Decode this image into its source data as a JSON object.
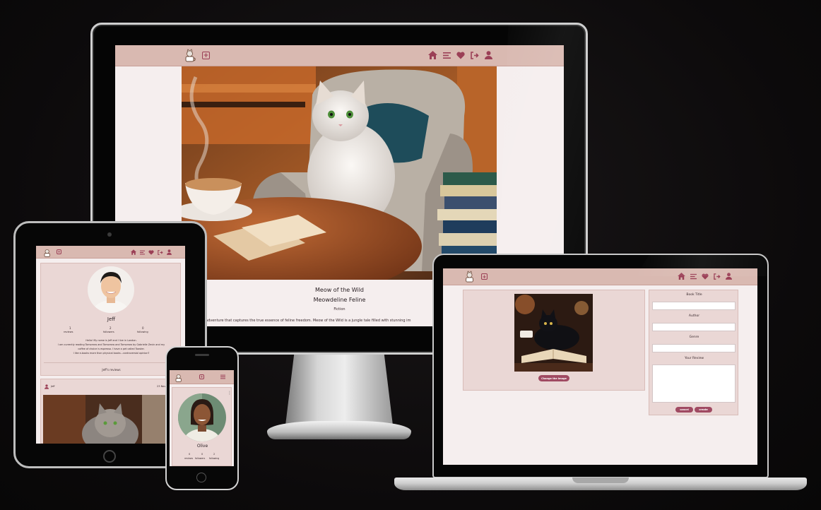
{
  "nav": {
    "icons": [
      "home-icon",
      "menu-icon",
      "heart-icon",
      "sign-out-icon",
      "user-icon"
    ],
    "add_icon": "plus-square-icon",
    "logo": "cat-coffee-logo"
  },
  "desktop": {
    "book_title": "Meow of the Wild",
    "book_author": "Meowdeline Feline",
    "book_genre": "Fiction",
    "book_blurb": "adventure that captures the true essence of feline freedom. Meow of the Wild is a jungle tale filled with stunning im"
  },
  "tablet": {
    "profile_name": "Jeff",
    "stats": [
      {
        "value": "1",
        "label": "reviews"
      },
      {
        "value": "2",
        "label": "followers"
      },
      {
        "value": "0",
        "label": "following"
      }
    ],
    "bio_lines": [
      "Hello! My name is Jeff and I live in London.",
      "I am currently reading Tomorrow and Tomorrow and Tomorrow by Gabrielle Zevin and my",
      "coffee of choice is espresso. I have a pet called Toaster.",
      "I like e-books more than physical books...controversial opinion?"
    ],
    "reviews_heading": "Jeff's reviews",
    "review_author": "Jeff",
    "review_date": "23 Nov"
  },
  "phone": {
    "profile_name": "Olive",
    "stats": [
      {
        "value": "0",
        "label": "reviews"
      },
      {
        "value": "0",
        "label": "followers"
      },
      {
        "value": "2",
        "label": "following"
      }
    ]
  },
  "laptop": {
    "change_image_label": "Change the image",
    "fields": [
      {
        "label": "Book Title",
        "value": ""
      },
      {
        "label": "Author",
        "value": ""
      },
      {
        "label": "Genre",
        "value": ""
      }
    ],
    "review_label": "Your Review",
    "cancel_label": "cancel",
    "create_label": "create"
  },
  "colors": {
    "nav_bg": "#d9b9b1",
    "accent": "#9b3f56",
    "page_bg": "#f5eeee",
    "card_bg": "#ead7d5"
  }
}
